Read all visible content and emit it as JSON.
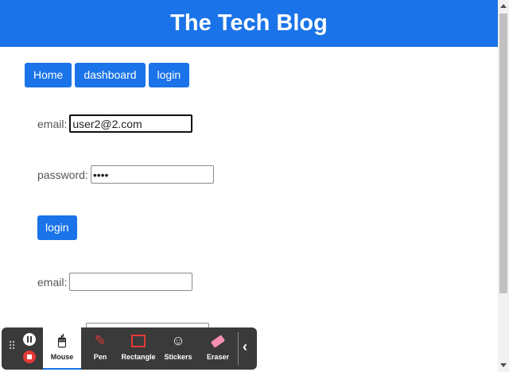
{
  "header": {
    "title": "The Tech Blog"
  },
  "nav": {
    "home": "Home",
    "dashboard": "dashboard",
    "login": "login"
  },
  "login_form": {
    "email_label": "email:",
    "email_value": "user2@2.com",
    "password_label": "password:",
    "password_value": "oooo",
    "submit_label": "login"
  },
  "signup_form": {
    "email_label": "email:",
    "email_value": ""
  },
  "toolbar": {
    "tools": [
      "Mouse",
      "Pen",
      "Rectangle",
      "Stickers",
      "Eraser"
    ]
  },
  "colors": {
    "accent": "#1a73e8",
    "toolbar_bg": "#3a3a3a",
    "record": "#e53935"
  }
}
